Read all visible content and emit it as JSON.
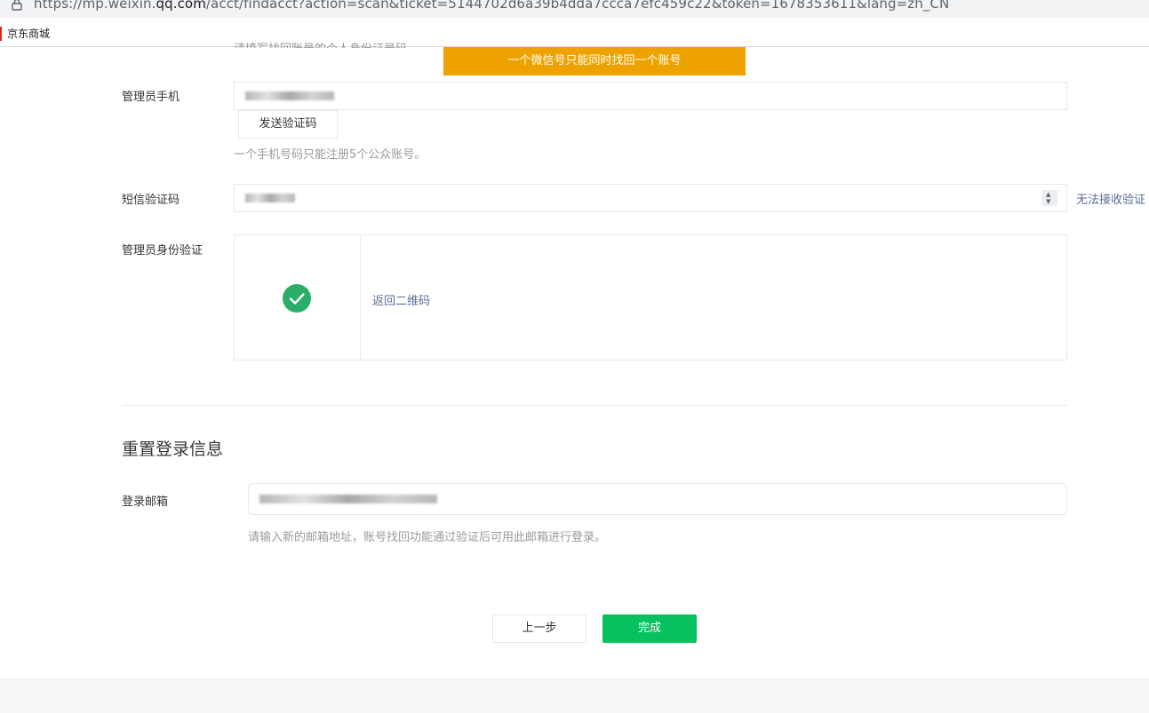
{
  "browser": {
    "url_prefix": "https://mp.weixin.",
    "url_domain": "qq.com",
    "url_suffix": "/acct/findacct?action=scan&ticket=5144702d6a39b4dda7ccca7efc459c22&token=1678353611&lang=zh_CN",
    "bookmark": "京东商城"
  },
  "top_tip": "请填写找回账号的个人身份证号码。",
  "toast": "一个微信号只能同时找回一个账号",
  "phone": {
    "label": "管理员手机",
    "send_code_button": "发送验证码",
    "hint": "一个手机号码只能注册5个公众账号。"
  },
  "sms": {
    "label": "短信验证码",
    "cannot_receive_link": "无法接收验证"
  },
  "identity": {
    "label": "管理员身份验证",
    "back_qr_link": "返回二维码"
  },
  "reset": {
    "title": "重置登录信息",
    "email_label": "登录邮箱",
    "email_hint": "请输入新的邮箱地址，账号找回功能通过验证后可用此邮箱进行登录。"
  },
  "actions": {
    "prev": "上一步",
    "done": "完成"
  },
  "colors": {
    "toast": "#eea200",
    "primary": "#07c160",
    "success": "#2aae67",
    "link": "#576b95"
  }
}
